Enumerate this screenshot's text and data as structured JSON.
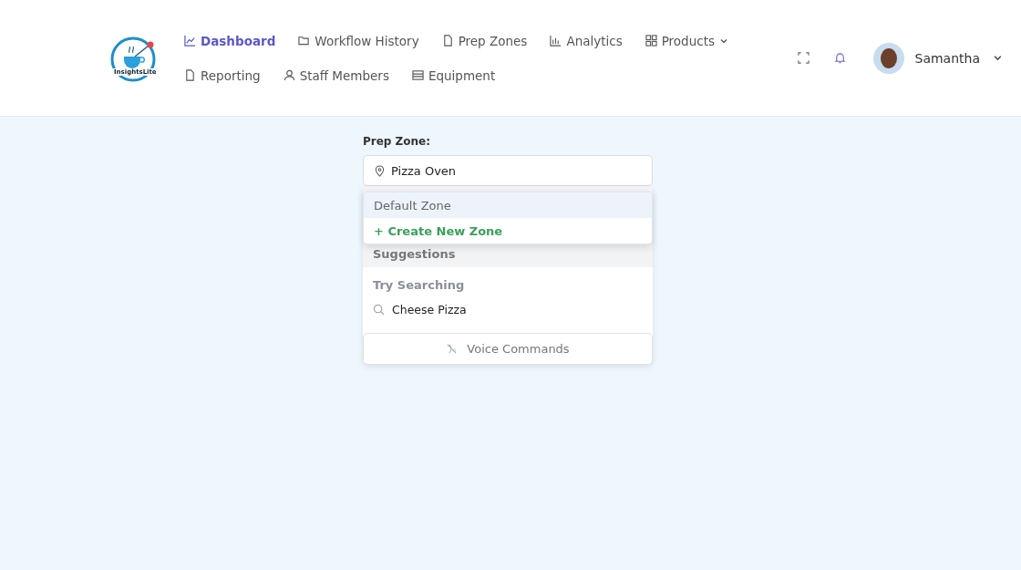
{
  "logo": {
    "text": "InsightsLite"
  },
  "nav": [
    {
      "label": "Dashboard",
      "kind": "chart",
      "selected": true,
      "has_menu": false
    },
    {
      "label": "Workflow History",
      "kind": "folder",
      "selected": false,
      "has_menu": false
    },
    {
      "label": "Prep Zones",
      "kind": "file",
      "selected": false,
      "has_menu": false
    },
    {
      "label": "Analytics",
      "kind": "bars",
      "selected": false,
      "has_menu": false
    },
    {
      "label": "Products",
      "kind": "grid",
      "selected": false,
      "has_menu": true
    },
    {
      "label": "Reporting",
      "kind": "file",
      "selected": false,
      "has_menu": false
    },
    {
      "label": "Staff Members",
      "kind": "user",
      "selected": false,
      "has_menu": false
    },
    {
      "label": "Equipment",
      "kind": "list",
      "selected": false,
      "has_menu": false
    }
  ],
  "user": {
    "name": "Samantha"
  },
  "prep_zone": {
    "label": "Prep Zone:",
    "value": "Pizza Oven",
    "options": [
      {
        "label": "Default Zone",
        "kind": "option",
        "selected": true
      },
      {
        "label": "+ Create New Zone",
        "kind": "create",
        "selected": false
      }
    ]
  },
  "suggestions": {
    "title": "Suggestions",
    "subtitle": "Try Searching",
    "items": [
      "Cheese Pizza"
    ]
  },
  "voice_button": {
    "label": "Voice Commands"
  }
}
